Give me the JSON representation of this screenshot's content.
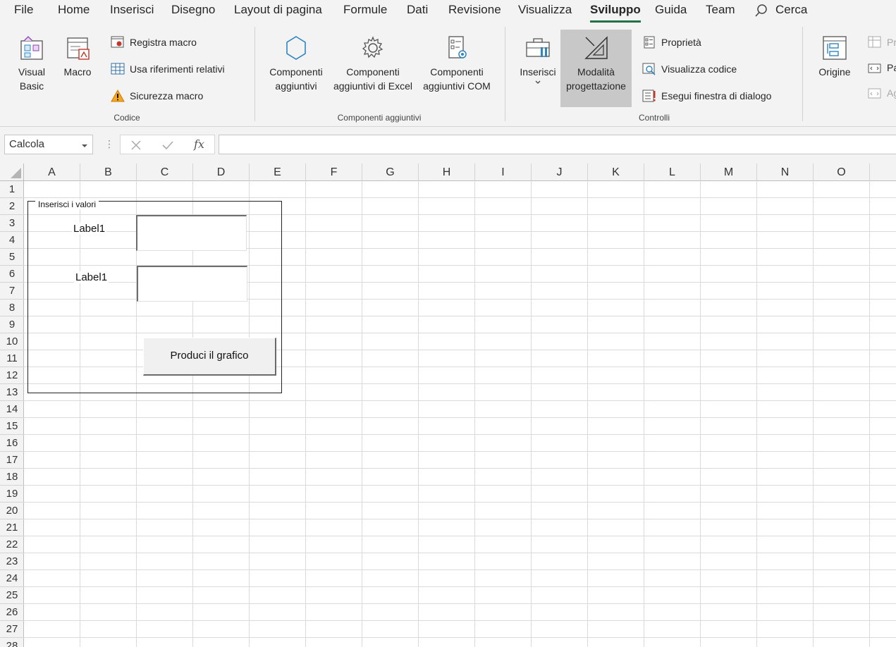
{
  "menu": {
    "tabs": [
      {
        "label": "File"
      },
      {
        "label": "Home"
      },
      {
        "label": "Inserisci"
      },
      {
        "label": "Disegno"
      },
      {
        "label": "Layout di pagina"
      },
      {
        "label": "Formule"
      },
      {
        "label": "Dati"
      },
      {
        "label": "Revisione"
      },
      {
        "label": "Visualizza"
      },
      {
        "label": "Sviluppo",
        "active": true
      },
      {
        "label": "Guida"
      },
      {
        "label": "Team"
      }
    ],
    "search_label": "Cerca"
  },
  "ribbon": {
    "codice": {
      "visual_basic_line1": "Visual",
      "visual_basic_line2": "Basic",
      "macro": "Macro",
      "registra_macro": "Registra macro",
      "usa_riferimenti": "Usa riferimenti relativi",
      "sicurezza_macro": "Sicurezza macro",
      "group_label": "Codice"
    },
    "componenti": {
      "comp_line1": "Componenti",
      "comp_line2": "aggiuntivi",
      "excel_line1": "Componenti",
      "excel_line2": "aggiuntivi di Excel",
      "com_line1": "Componenti",
      "com_line2": "aggiuntivi COM",
      "group_label": "Componenti aggiuntivi"
    },
    "controlli": {
      "inserisci": "Inserisci",
      "modalita_line1": "Modalità",
      "modalita_line2": "progettazione",
      "proprieta": "Proprietà",
      "visualizza_codice": "Visualizza codice",
      "esegui_finestra": "Esegui finestra di dialogo",
      "group_label": "Controlli"
    },
    "xml": {
      "origine": "Origine",
      "cut_1": "Pr",
      "cut_2": "Pa",
      "cut_3": "Ag"
    }
  },
  "formula_bar": {
    "name_box": "Calcola",
    "fx_label": "fx",
    "formula": ""
  },
  "sheet": {
    "columns": [
      "A",
      "B",
      "C",
      "D",
      "E",
      "F",
      "G",
      "H",
      "I",
      "J",
      "K",
      "L",
      "M",
      "N",
      "O"
    ],
    "rows": [
      "1",
      "2",
      "3",
      "4",
      "5",
      "6",
      "7",
      "8",
      "9",
      "10",
      "11",
      "12",
      "13",
      "14",
      "15",
      "16",
      "17",
      "18",
      "19",
      "20",
      "21",
      "22",
      "23",
      "24",
      "25",
      "26",
      "27",
      "28"
    ]
  },
  "form": {
    "group_caption": "Inserisci i valori",
    "label1": "Label1",
    "label2": "Label1",
    "button": "Produci il grafico"
  }
}
